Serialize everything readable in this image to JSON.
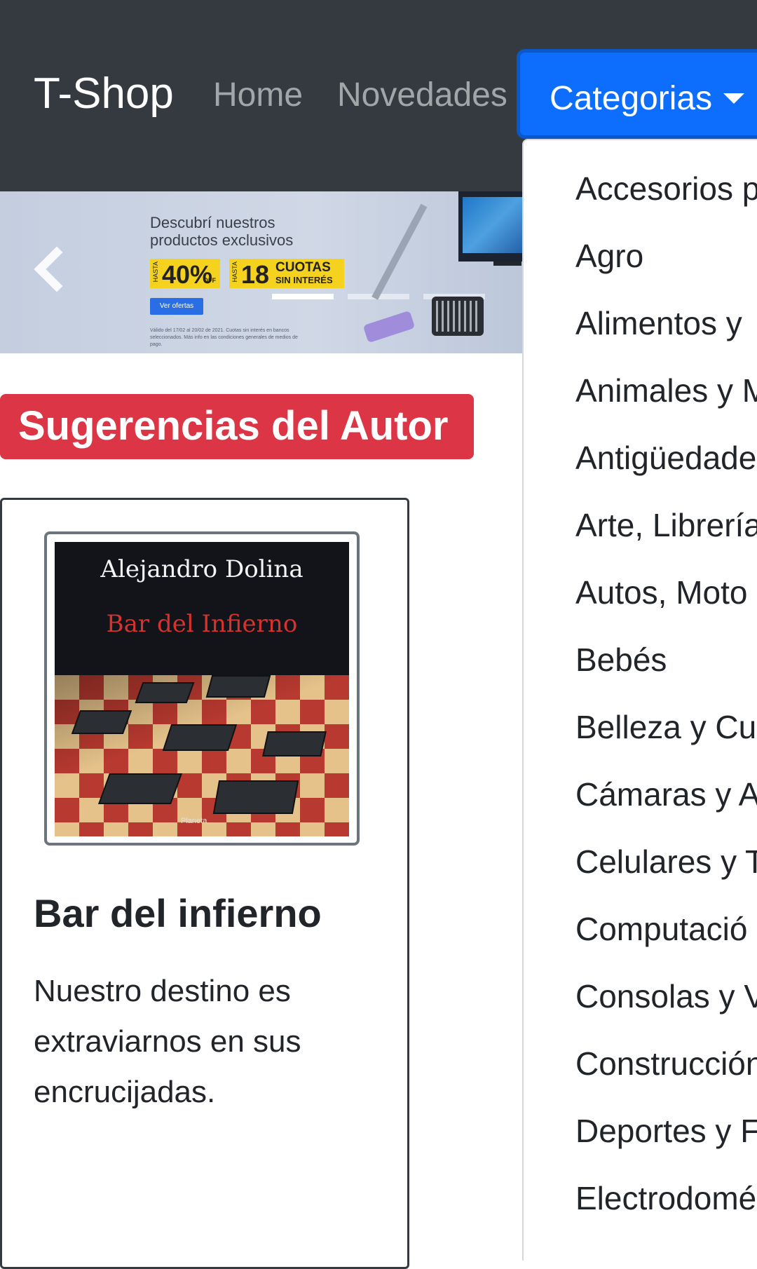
{
  "navbar": {
    "brand": "T-Shop",
    "links": [
      "Home",
      "Novedades"
    ],
    "dropdown_label": "Categorias"
  },
  "carousel": {
    "headline": "Descubrí nuestros productos exclusivos",
    "badge1": {
      "prefix": "HASTA",
      "value": "40%",
      "suffix": "OFF"
    },
    "badge2": {
      "prefix": "HASTA",
      "value": "18",
      "line1": "CUOTAS",
      "line2": "SIN INTERÉS"
    },
    "cta": "Ver ofertas",
    "legal": "Válido del 17/02 al 20/02 de 2021. Cuotas sin interés en bancos seleccionados. Más info en las condiciones generales de medios de pago.",
    "slides_total": 3,
    "active_slide": 1
  },
  "section": {
    "title": "Sugerencias del Autor"
  },
  "product": {
    "cover_author": "Alejandro Dolina",
    "cover_title": "Bar del Infierno",
    "cover_publisher": "Planeta",
    "title": "Bar del infierno",
    "description": "Nuestro destino es extraviarnos en sus encrucijadas."
  },
  "categories": [
    "Accesorios p",
    "Agro",
    "Alimentos y",
    "Animales y M",
    "Antigüedade",
    "Arte, Librería",
    "Autos, Moto",
    "Bebés",
    "Belleza y Cu",
    "Cámaras y A",
    "Celulares y T",
    "Computació",
    "Consolas y V",
    "Construcción",
    "Deportes y F",
    "Electrodomé"
  ],
  "colors": {
    "navbar_bg": "#343a40",
    "primary": "#0d6efd",
    "danger": "#dc3545",
    "badge_yellow": "#f5d21e"
  }
}
